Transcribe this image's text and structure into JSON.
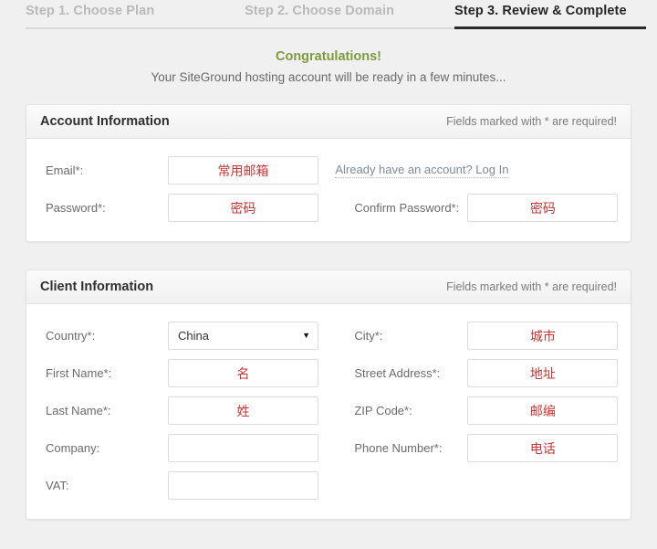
{
  "steps": [
    {
      "label": "Step 1. Choose Plan",
      "state": "inactive"
    },
    {
      "label": "Step 2. Choose Domain",
      "state": "inactive"
    },
    {
      "label": "Step 3. Review & Complete",
      "state": "active"
    }
  ],
  "intro": {
    "congrats": "Congratulations!",
    "subtitle": "Your SiteGround hosting account will be ready in a few minutes..."
  },
  "colors": {
    "accent_green": "#7e9c3d",
    "value_red": "#cc3333",
    "link": "#7d8b95",
    "active_step": "#262626",
    "inactive_step": "#b9b9b9"
  },
  "account_panel": {
    "title": "Account Information",
    "note": "Fields marked with * are required!",
    "email_label": "Email*:",
    "email_value": "常用邮箱",
    "login_link": "Already have an account? Log In",
    "password_label": "Password*:",
    "password_value": "密码",
    "confirm_password_label": "Confirm Password*:",
    "confirm_password_value": "密码"
  },
  "client_panel": {
    "title": "Client Information",
    "note": "Fields marked with * are required!",
    "country_label": "Country*:",
    "country_value": "China",
    "country_caret": "▼",
    "city_label": "City*:",
    "city_value": "城市",
    "first_name_label": "First Name*:",
    "first_name_value": "名",
    "street_label": "Street Address*:",
    "street_value": "地址",
    "last_name_label": "Last Name*:",
    "last_name_value": "姓",
    "zip_label": "ZIP Code*:",
    "zip_value": "邮编",
    "company_label": "Company:",
    "company_value": "",
    "phone_label": "Phone Number*:",
    "phone_value": "电话",
    "vat_label": "VAT:",
    "vat_value": ""
  }
}
